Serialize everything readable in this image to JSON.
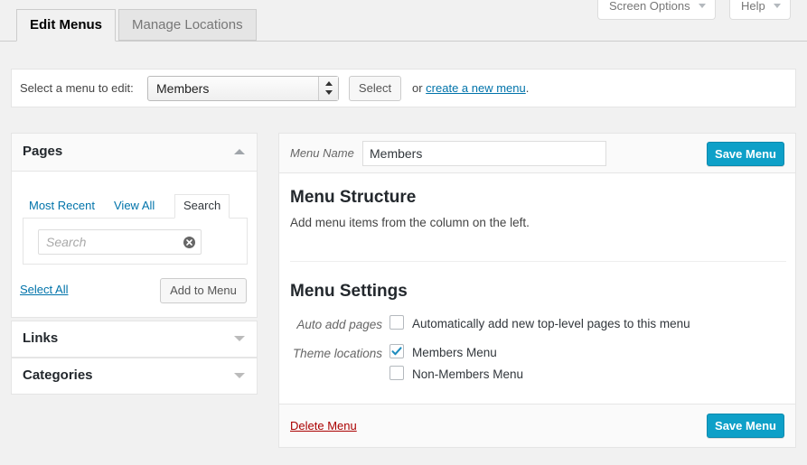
{
  "meta": {
    "screen_options_label": "Screen Options",
    "help_label": "Help"
  },
  "tabs": [
    {
      "label": "Edit Menus",
      "active": true
    },
    {
      "label": "Manage Locations",
      "active": false
    }
  ],
  "select_bar": {
    "label": "Select a menu to edit:",
    "selected_menu": "Members",
    "select_button": "Select",
    "or_prefix": "or ",
    "create_link": "create a new menu",
    "or_suffix": "."
  },
  "sidebar": {
    "pages_panel": {
      "title": "Pages",
      "tabs": [
        {
          "label": "Most Recent",
          "active": false
        },
        {
          "label": "View All",
          "active": false
        },
        {
          "label": "Search",
          "active": true
        }
      ],
      "search_placeholder": "Search",
      "search_value": "",
      "select_all_label": "Select All",
      "add_to_menu_label": "Add to Menu"
    },
    "links_panel": {
      "title": "Links"
    },
    "categories_panel": {
      "title": "Categories"
    }
  },
  "menu_editor": {
    "menu_name_label": "Menu Name",
    "menu_name_value": "Members",
    "save_menu_label": "Save Menu",
    "structure_title": "Menu Structure",
    "structure_desc": "Add menu items from the column on the left.",
    "settings_title": "Menu Settings",
    "auto_add_label": "Auto add pages",
    "auto_add_option": "Automatically add new top-level pages to this menu",
    "auto_add_checked": false,
    "theme_locations_label": "Theme locations",
    "theme_locations": [
      {
        "label": "Members Menu",
        "checked": true
      },
      {
        "label": "Non-Members Menu",
        "checked": false
      }
    ],
    "delete_menu_label": "Delete Menu",
    "save_menu_bottom_label": "Save Menu"
  },
  "colors": {
    "primary": "#0ea0c8",
    "link": "#0073aa",
    "danger": "#a00",
    "page_bg": "#f1f1f1"
  }
}
